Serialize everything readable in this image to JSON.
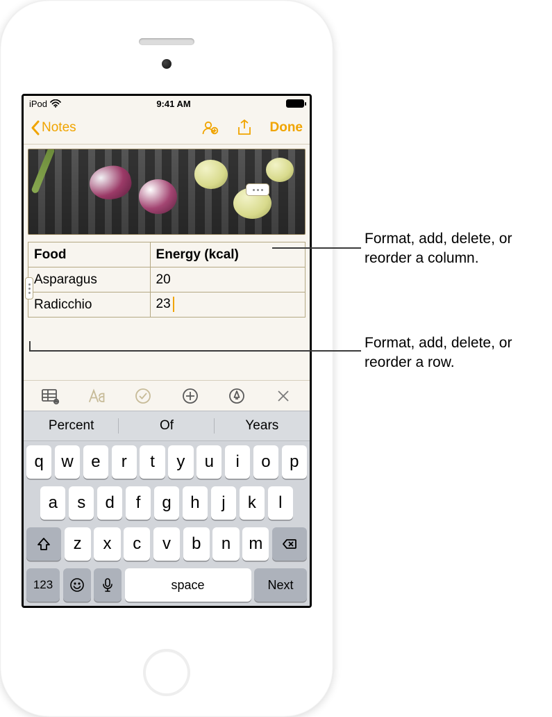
{
  "status_bar": {
    "device": "iPod",
    "time": "9:41 AM"
  },
  "nav": {
    "back_label": "Notes",
    "done_label": "Done"
  },
  "table": {
    "headers": [
      "Food",
      "Energy (kcal)"
    ],
    "rows": [
      {
        "food": "Asparagus",
        "energy": "20"
      },
      {
        "food": "Radicchio",
        "energy": "23"
      }
    ]
  },
  "keyboard": {
    "suggestions": [
      "Percent",
      "Of",
      "Years"
    ],
    "row1": [
      "q",
      "w",
      "e",
      "r",
      "t",
      "y",
      "u",
      "i",
      "o",
      "p"
    ],
    "row2": [
      "a",
      "s",
      "d",
      "f",
      "g",
      "h",
      "j",
      "k",
      "l"
    ],
    "row3": [
      "z",
      "x",
      "c",
      "v",
      "b",
      "n",
      "m"
    ],
    "numkey": "123",
    "space_label": "space",
    "next_label": "Next"
  },
  "callouts": {
    "column": "Format, add, delete, or reorder a column.",
    "row": "Format, add, delete, or reorder a row."
  },
  "colors": {
    "accent": "#f0a400"
  }
}
